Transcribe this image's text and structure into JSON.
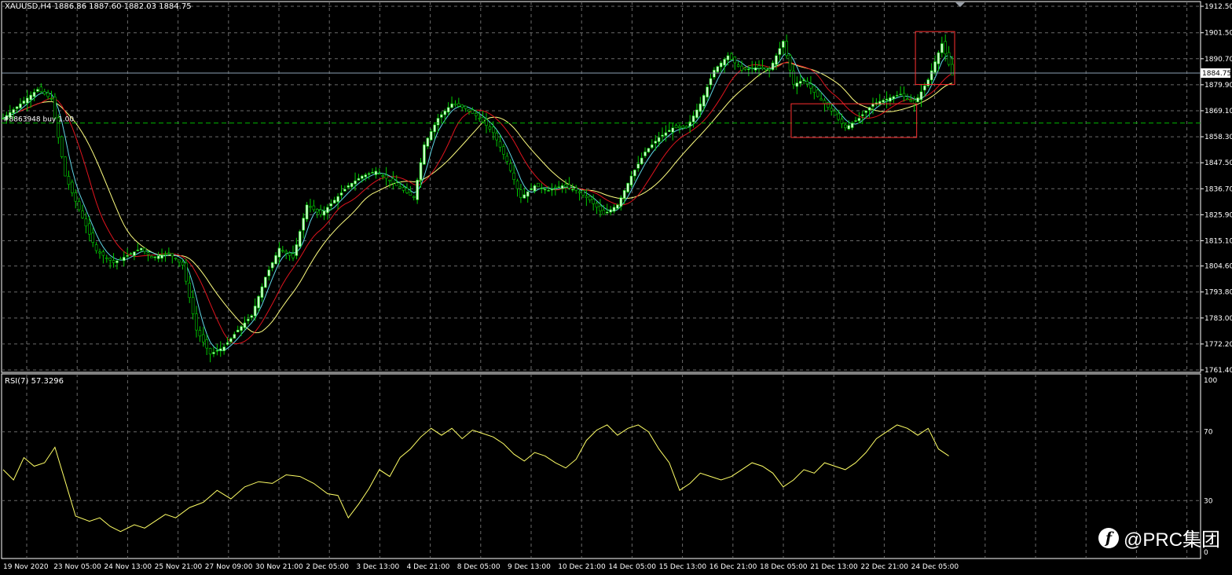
{
  "header": {
    "symbol_info": "XAUUSD,H4  1886.86 1887.60 1882.03 1884.75",
    "order_label": "#8863948 buy 1.00"
  },
  "price_axis": {
    "ticks": [
      "1912.50",
      "1901.50",
      "1890.70",
      "1879.90",
      "1869.10",
      "1858.30",
      "1847.50",
      "1836.70",
      "1825.90",
      "1815.10",
      "1804.60",
      "1793.80",
      "1783.00",
      "1772.20",
      "1761.40"
    ],
    "current_price": "1884.75",
    "order_price": 1864
  },
  "rsi": {
    "label": "RSI(7) 57.3296",
    "period": 7,
    "ticks": [
      "100",
      "70",
      "30",
      "0"
    ],
    "levels": [
      70,
      30
    ]
  },
  "time_axis": {
    "labels": [
      "19 Nov 2020",
      "23 Nov 05:00",
      "24 Nov 13:00",
      "25 Nov 21:00",
      "27 Nov 09:00",
      "30 Nov 21:00",
      "2 Dec 05:00",
      "3 Dec 13:00",
      "4 Dec 21:00",
      "8 Dec 05:00",
      "9 Dec 13:00",
      "10 Dec 21:00",
      "14 Dec 05:00",
      "15 Dec 13:00",
      "16 Dec 21:00",
      "18 Dec 05:00",
      "21 Dec 13:00",
      "22 Dec 21:00",
      "24 Dec 05:00"
    ]
  },
  "watermark": {
    "text": "@PRC集团"
  },
  "colors": {
    "background": "#000000",
    "grid": "#6a6a6a",
    "bull_candle": "#ccffcc",
    "bear_candle": "#ccffcc",
    "wick": "#00cc00",
    "ma_fast": "#5fd7e6",
    "ma_mid": "#e0141e",
    "ma_slow": "#ffff80",
    "rsi_line": "#ffff66",
    "box": "#ff3030",
    "order_line": "#00b400"
  },
  "chart_data": {
    "type": "candlestick",
    "title": "XAUUSD,H4",
    "ylim": [
      1761.4,
      1912.5
    ],
    "overlays": [
      "MA fast (cyan)",
      "MA mid (red)",
      "MA slow (yellow)"
    ],
    "close_path": [
      [
        0,
        1866
      ],
      [
        5,
        1872
      ],
      [
        10,
        1878
      ],
      [
        14,
        1874
      ],
      [
        18,
        1842
      ],
      [
        22,
        1828
      ],
      [
        27,
        1811
      ],
      [
        32,
        1806
      ],
      [
        36,
        1809
      ],
      [
        40,
        1812
      ],
      [
        43,
        1808
      ],
      [
        48,
        1810
      ],
      [
        52,
        1805
      ],
      [
        56,
        1778
      ],
      [
        60,
        1768
      ],
      [
        64,
        1771
      ],
      [
        68,
        1778
      ],
      [
        72,
        1784
      ],
      [
        76,
        1800
      ],
      [
        80,
        1812
      ],
      [
        84,
        1808
      ],
      [
        88,
        1830
      ],
      [
        92,
        1826
      ],
      [
        96,
        1832
      ],
      [
        100,
        1838
      ],
      [
        104,
        1842
      ],
      [
        108,
        1844
      ],
      [
        112,
        1840
      ],
      [
        116,
        1836
      ],
      [
        119,
        1833
      ],
      [
        122,
        1855
      ],
      [
        126,
        1866
      ],
      [
        130,
        1872
      ],
      [
        134,
        1870
      ],
      [
        138,
        1866
      ],
      [
        142,
        1860
      ],
      [
        146,
        1848
      ],
      [
        150,
        1833
      ],
      [
        154,
        1838
      ],
      [
        158,
        1836
      ],
      [
        162,
        1838
      ],
      [
        166,
        1836
      ],
      [
        170,
        1832
      ],
      [
        174,
        1826
      ],
      [
        178,
        1830
      ],
      [
        182,
        1842
      ],
      [
        186,
        1852
      ],
      [
        190,
        1858
      ],
      [
        194,
        1862
      ],
      [
        198,
        1862
      ],
      [
        202,
        1872
      ],
      [
        206,
        1886
      ],
      [
        210,
        1892
      ],
      [
        214,
        1886
      ],
      [
        218,
        1887
      ],
      [
        222,
        1886
      ],
      [
        226,
        1898
      ],
      [
        229,
        1880
      ],
      [
        232,
        1882
      ],
      [
        236,
        1875
      ],
      [
        240,
        1869
      ],
      [
        244,
        1862
      ],
      [
        248,
        1866
      ],
      [
        252,
        1872
      ],
      [
        256,
        1874
      ],
      [
        260,
        1876
      ],
      [
        264,
        1872
      ],
      [
        268,
        1882
      ],
      [
        272,
        1897
      ],
      [
        275,
        1884
      ]
    ],
    "bars_count": 276,
    "boxes": [
      {
        "from_bar": 229,
        "to_bar": 264,
        "high": 1872,
        "low": 1858
      },
      {
        "from_bar": 265,
        "to_bar": 275,
        "high": 1902,
        "low": 1880
      }
    ],
    "rsi_values": [
      [
        0,
        48
      ],
      [
        3,
        42
      ],
      [
        6,
        55
      ],
      [
        9,
        50
      ],
      [
        12,
        52
      ],
      [
        15,
        61
      ],
      [
        18,
        41
      ],
      [
        21,
        21
      ],
      [
        25,
        18
      ],
      [
        28,
        20
      ],
      [
        31,
        15
      ],
      [
        34,
        12
      ],
      [
        38,
        16
      ],
      [
        41,
        14
      ],
      [
        44,
        18
      ],
      [
        47,
        22
      ],
      [
        50,
        20
      ],
      [
        54,
        26
      ],
      [
        58,
        29
      ],
      [
        62,
        36
      ],
      [
        66,
        31
      ],
      [
        70,
        38
      ],
      [
        74,
        41
      ],
      [
        78,
        40
      ],
      [
        82,
        45
      ],
      [
        86,
        44
      ],
      [
        90,
        40
      ],
      [
        94,
        34
      ],
      [
        97,
        33
      ],
      [
        100,
        20
      ],
      [
        103,
        28
      ],
      [
        106,
        37
      ],
      [
        109,
        48
      ],
      [
        112,
        44
      ],
      [
        115,
        55
      ],
      [
        118,
        60
      ],
      [
        121,
        67
      ],
      [
        124,
        72
      ],
      [
        127,
        68
      ],
      [
        130,
        72
      ],
      [
        133,
        66
      ],
      [
        136,
        71
      ],
      [
        139,
        69
      ],
      [
        142,
        67
      ],
      [
        145,
        63
      ],
      [
        148,
        57
      ],
      [
        151,
        53
      ],
      [
        154,
        58
      ],
      [
        157,
        56
      ],
      [
        160,
        52
      ],
      [
        163,
        49
      ],
      [
        166,
        54
      ],
      [
        169,
        65
      ],
      [
        172,
        71
      ],
      [
        175,
        74
      ],
      [
        178,
        68
      ],
      [
        181,
        72
      ],
      [
        184,
        74
      ],
      [
        187,
        70
      ],
      [
        190,
        60
      ],
      [
        193,
        52
      ],
      [
        196,
        36
      ],
      [
        199,
        40
      ],
      [
        202,
        46
      ],
      [
        205,
        44
      ],
      [
        208,
        42
      ],
      [
        211,
        44
      ],
      [
        214,
        48
      ],
      [
        217,
        52
      ],
      [
        220,
        50
      ],
      [
        223,
        46
      ],
      [
        226,
        38
      ],
      [
        229,
        42
      ],
      [
        232,
        48
      ],
      [
        235,
        46
      ],
      [
        238,
        52
      ],
      [
        241,
        50
      ],
      [
        244,
        48
      ],
      [
        247,
        52
      ],
      [
        250,
        58
      ],
      [
        253,
        66
      ],
      [
        256,
        70
      ],
      [
        259,
        74
      ],
      [
        262,
        72
      ],
      [
        265,
        68
      ],
      [
        268,
        72
      ],
      [
        271,
        60
      ],
      [
        274,
        56
      ]
    ]
  }
}
